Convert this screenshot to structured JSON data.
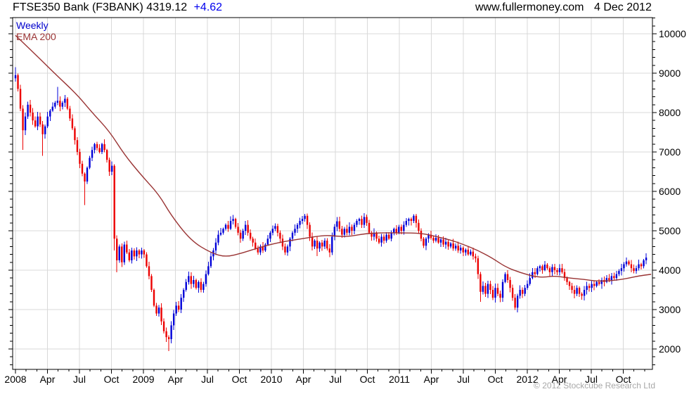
{
  "header": {
    "title": "FTSE350 Bank (F3BANK) 4319.12",
    "change": "+4.62",
    "website": "www.fullermoney.com",
    "date": "4 Dec 2012"
  },
  "legend": {
    "timeframe": "Weekly",
    "indicator": "EMA 200"
  },
  "footer": {
    "copyright": "© 2012 Stockcube Research Ltd"
  },
  "colors": {
    "up_candle": "#0000d8",
    "down_candle": "#ec0000",
    "ema_line": "#993333",
    "grid": "#d9d9d9",
    "axis": "#000000",
    "change_text": "#0000ee",
    "timeframe_text": "#0000cc",
    "copyright_text": "#a8a8a8"
  },
  "chart_data": {
    "type": "candlestick",
    "title": "FTSE350 Bank (F3BANK) weekly with 200-week EMA",
    "interval": "weekly",
    "x_range": [
      "Jan 2008",
      "Dec 2012"
    ],
    "ylim": [
      1500,
      10400
    ],
    "grid": true,
    "y_ticks": [
      10000,
      9000,
      8000,
      7000,
      6000,
      5000,
      4000,
      3000,
      2000
    ],
    "x_ticks": [
      {
        "label": "2008",
        "month": 0
      },
      {
        "label": "Apr",
        "month": 3
      },
      {
        "label": "Jul",
        "month": 6
      },
      {
        "label": "Oct",
        "month": 9
      },
      {
        "label": "2009",
        "month": 12
      },
      {
        "label": "Apr",
        "month": 15
      },
      {
        "label": "Jul",
        "month": 18
      },
      {
        "label": "Oct",
        "month": 21
      },
      {
        "label": "2010",
        "month": 24
      },
      {
        "label": "Apr",
        "month": 27
      },
      {
        "label": "Jul",
        "month": 30
      },
      {
        "label": "Oct",
        "month": 33
      },
      {
        "label": "2011",
        "month": 36
      },
      {
        "label": "Apr",
        "month": 39
      },
      {
        "label": "Jul",
        "month": 42
      },
      {
        "label": "Oct",
        "month": 45
      },
      {
        "label": "2012",
        "month": 48
      },
      {
        "label": "Apr",
        "month": 51
      },
      {
        "label": "Jul",
        "month": 54
      },
      {
        "label": "Oct",
        "month": 57
      }
    ],
    "first_open": 8870,
    "weekly_closes": [
      8950,
      8600,
      8100,
      7550,
      7900,
      8200,
      8000,
      7800,
      7650,
      7900,
      7700,
      7450,
      7650,
      7900,
      8050,
      8150,
      8250,
      8300,
      8150,
      8250,
      8350,
      8100,
      7850,
      7600,
      7300,
      7000,
      6700,
      6450,
      6250,
      6600,
      6850,
      7050,
      7200,
      7100,
      7000,
      7200,
      7050,
      6800,
      6500,
      6650,
      4800,
      4250,
      4600,
      4200,
      4650,
      4450,
      4250,
      4500,
      4350,
      4500,
      4400,
      4500,
      4400,
      4100,
      3850,
      3500,
      3100,
      2900,
      3050,
      2700,
      2450,
      2300,
      2250,
      2600,
      2900,
      3100,
      3000,
      3300,
      3500,
      3700,
      3850,
      3650,
      3750,
      3550,
      3700,
      3500,
      3650,
      3900,
      4100,
      4350,
      4500,
      4700,
      4900,
      4950,
      5050,
      5150,
      5050,
      5250,
      5300,
      5100,
      4950,
      4800,
      5000,
      5150,
      4950,
      4800,
      4700,
      4550,
      4450,
      4600,
      4500,
      4650,
      4800,
      4950,
      5050,
      5120,
      4950,
      4800,
      4600,
      4450,
      4600,
      4800,
      4950,
      5050,
      5150,
      5250,
      5300,
      5380,
      5150,
      4850,
      4600,
      4750,
      4550,
      4700,
      4600,
      4750,
      4550,
      4450,
      4850,
      5100,
      5240,
      5050,
      4900,
      5050,
      4950,
      5100,
      5000,
      5150,
      5250,
      5300,
      5150,
      5350,
      5200,
      4950,
      4850,
      4950,
      4800,
      4700,
      4850,
      4750,
      4900,
      4800,
      4950,
      5050,
      4950,
      5100,
      5000,
      5150,
      5250,
      5300,
      5250,
      5380,
      5200,
      5000,
      4800,
      4620,
      4800,
      4900,
      4820,
      4750,
      4820,
      4700,
      4780,
      4650,
      4720,
      4600,
      4680,
      4550,
      4620,
      4500,
      4570,
      4450,
      4520,
      4400,
      4470,
      4350,
      4300,
      3900,
      3450,
      3600,
      3400,
      3650,
      3500,
      3300,
      3550,
      3400,
      3300,
      3700,
      3900,
      3750,
      3550,
      3300,
      3050,
      3350,
      3500,
      3400,
      3550,
      3650,
      3800,
      3950,
      3900,
      4050,
      4100,
      4000,
      4140,
      4050,
      3950,
      4080,
      4000,
      3950,
      4050,
      3950,
      3800,
      3700,
      3600,
      3500,
      3400,
      3550,
      3400,
      3350,
      3500,
      3600,
      3550,
      3650,
      3600,
      3700,
      3650,
      3750,
      3700,
      3800,
      3750,
      3850,
      3800,
      3900,
      3980,
      4050,
      4150,
      4220,
      4150,
      4050,
      3980,
      4050,
      4150,
      4100,
      4250,
      4319
    ],
    "wick_overrides": {
      "0": {
        "high": 9150
      },
      "3": {
        "low": 7050
      },
      "11": {
        "low": 6900
      },
      "17": {
        "high": 8650
      },
      "28": {
        "low": 5650
      },
      "40": {
        "low": 4500
      },
      "41": {
        "low": 3950
      },
      "62": {
        "low": 1950
      },
      "88": {
        "high": 5400
      },
      "117": {
        "high": 5430
      },
      "122": {
        "low": 4360
      },
      "161": {
        "high": 5420
      },
      "188": {
        "low": 3200
      },
      "202": {
        "low": 2990
      },
      "214": {
        "high": 4230
      },
      "226": {
        "low": 3290
      },
      "255": {
        "high": 4430
      }
    },
    "ema200": [
      [
        0,
        9960
      ],
      [
        8,
        9480
      ],
      [
        16,
        8985
      ],
      [
        25,
        8450
      ],
      [
        31,
        8000
      ],
      [
        38,
        7525
      ],
      [
        44,
        6935
      ],
      [
        51,
        6400
      ],
      [
        58,
        5920
      ],
      [
        63,
        5385
      ],
      [
        71,
        4745
      ],
      [
        79,
        4440
      ],
      [
        85,
        4330
      ],
      [
        92,
        4440
      ],
      [
        99,
        4585
      ],
      [
        107,
        4710
      ],
      [
        116,
        4800
      ],
      [
        125,
        4890
      ],
      [
        130,
        4860
      ],
      [
        135,
        4855
      ],
      [
        141,
        4925
      ],
      [
        148,
        4950
      ],
      [
        156,
        4945
      ],
      [
        164,
        4940
      ],
      [
        170,
        4855
      ],
      [
        176,
        4765
      ],
      [
        181,
        4655
      ],
      [
        187,
        4500
      ],
      [
        193,
        4300
      ],
      [
        198,
        4085
      ],
      [
        204,
        3940
      ],
      [
        210,
        3835
      ],
      [
        214,
        3820
      ],
      [
        218,
        3855
      ],
      [
        224,
        3800
      ],
      [
        230,
        3765
      ],
      [
        235,
        3720
      ],
      [
        241,
        3730
      ],
      [
        247,
        3785
      ],
      [
        252,
        3855
      ],
      [
        257,
        3895
      ]
    ]
  }
}
